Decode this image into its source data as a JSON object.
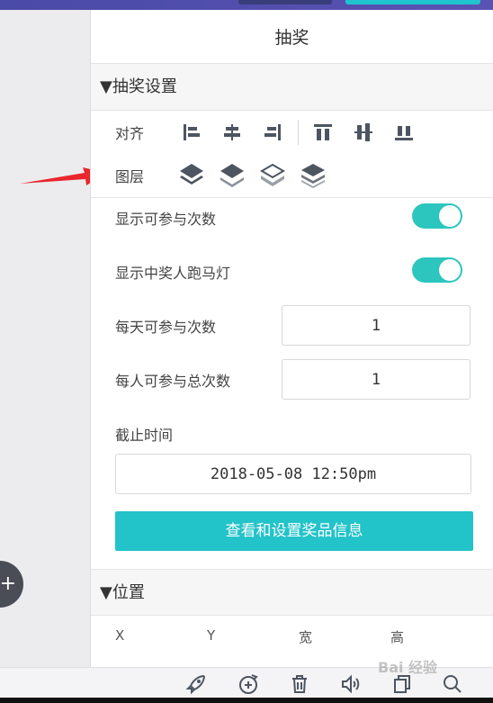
{
  "panel": {
    "title": "抽奖"
  },
  "lottery_section": {
    "label": "▼抽奖设置",
    "align_label": "对齐",
    "layer_label": "图层",
    "align_icons": [
      "align-left-icon",
      "align-center-h-icon",
      "align-right-icon",
      "align-top-icon",
      "align-center-v-icon",
      "align-bottom-icon"
    ],
    "layer_icons": [
      "layer-top-icon",
      "layer-up-icon",
      "layer-down-icon",
      "layer-bottom-icon"
    ],
    "show_count_label": "显示可参与次数",
    "show_count_on": true,
    "show_marquee_label": "显示中奖人跑马灯",
    "show_marquee_on": true,
    "daily_label": "每天可参与次数",
    "daily_value": "1",
    "total_label": "每人可参与总次数",
    "total_value": "1",
    "deadline_label": "截止时间",
    "deadline_value": "2018-05-08 12:50pm",
    "prize_button": "查看和设置奖品信息"
  },
  "position_section": {
    "label": "▼位置",
    "x_label": "X",
    "y_label": "Y",
    "width_label": "宽",
    "height_label": "高"
  },
  "watermark": "Bai 经验",
  "colors": {
    "accent": "#22c3c9",
    "toggle": "#2cc6be",
    "arrow": "#e8262c",
    "topbar": "#4a4aa8"
  }
}
